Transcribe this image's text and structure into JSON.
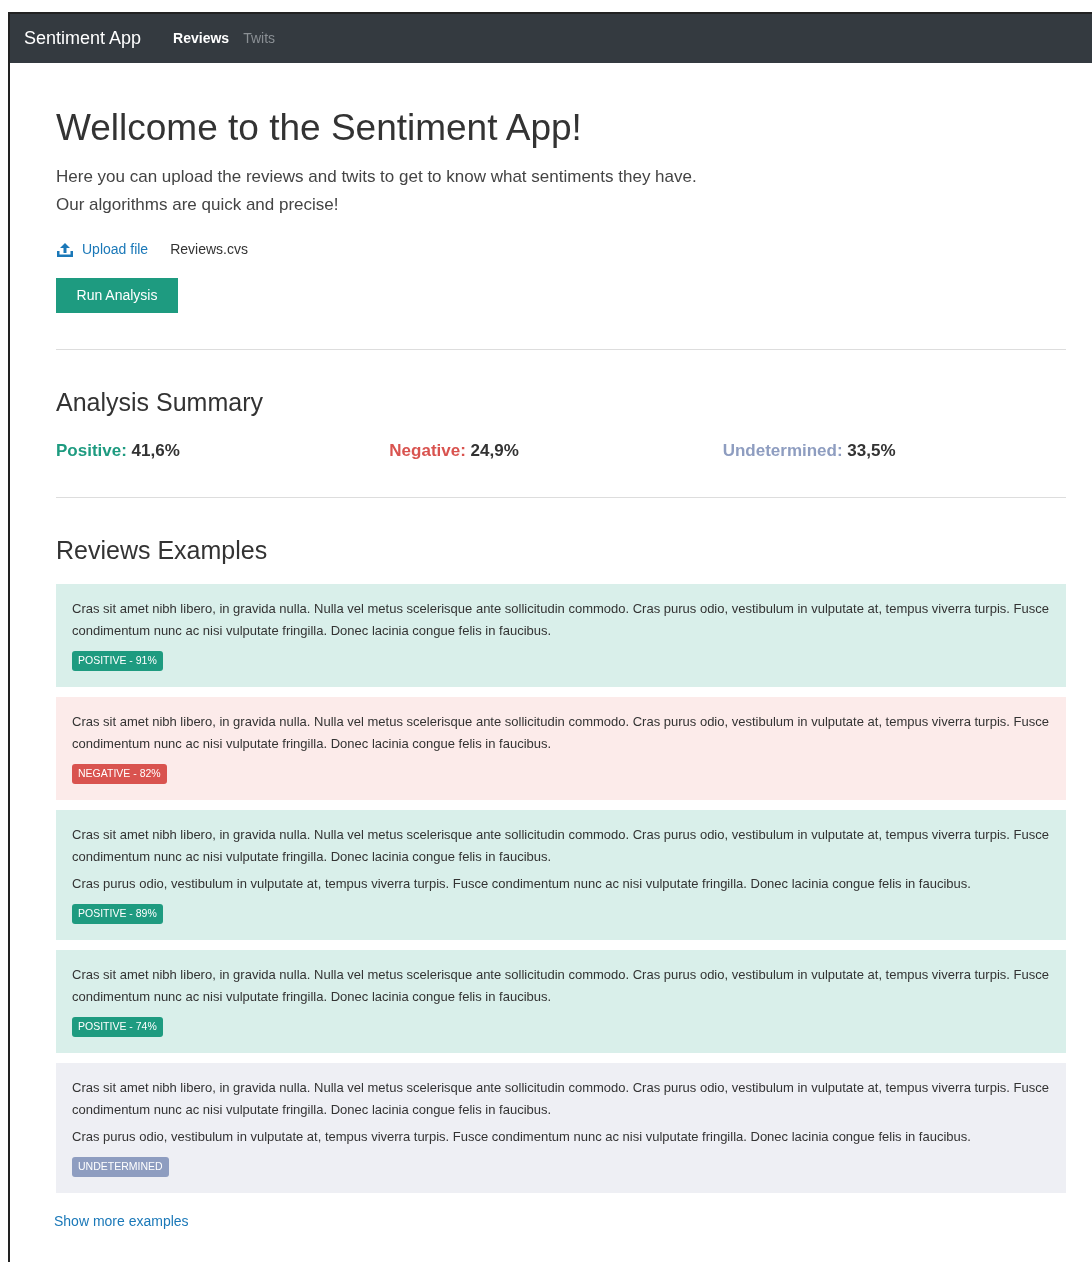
{
  "navbar": {
    "brand": "Sentiment App",
    "tabs": [
      {
        "label": "Reviews",
        "selected": true
      },
      {
        "label": "Twits",
        "selected": false
      }
    ]
  },
  "header": {
    "title": "Wellcome to the Sentiment App!",
    "lines": [
      "Here you can upload the reviews and twits to get to know what sentiments they have.",
      "Our algorithms are quick and precise!"
    ]
  },
  "upload": {
    "link": "Upload file",
    "filename": "Reviews.cvs"
  },
  "run_button": "Run Analysis",
  "summary": {
    "title": "Analysis Summary",
    "items": [
      {
        "kind": "positive",
        "label": "Positive:",
        "value": "41,6%"
      },
      {
        "kind": "negative",
        "label": "Negative:",
        "value": "24,9%"
      },
      {
        "kind": "undetermined",
        "label": "Undetermined:",
        "value": "33,5%"
      }
    ]
  },
  "examples": {
    "title": "Reviews Examples",
    "reviews": [
      {
        "kind": "positive",
        "paragraphs": [
          "Cras sit amet nibh libero, in gravida nulla. Nulla vel metus scelerisque ante sollicitudin commodo. Cras purus odio, vestibulum in vulputate at, tempus viverra turpis. Fusce condimentum nunc ac nisi vulputate fringilla. Donec lacinia congue felis in faucibus."
        ],
        "badge": "POSITIVE - 91%"
      },
      {
        "kind": "negative",
        "paragraphs": [
          "Cras sit amet nibh libero, in gravida nulla. Nulla vel metus scelerisque ante sollicitudin commodo. Cras purus odio, vestibulum in vulputate at, tempus viverra turpis. Fusce condimentum nunc ac nisi vulputate fringilla. Donec lacinia congue felis in faucibus."
        ],
        "badge": "NEGATIVE - 82%"
      },
      {
        "kind": "positive",
        "paragraphs": [
          "Cras sit amet nibh libero, in gravida nulla. Nulla vel metus scelerisque ante sollicitudin commodo. Cras purus odio, vestibulum in vulputate at, tempus viverra turpis. Fusce condimentum nunc ac nisi vulputate fringilla. Donec lacinia congue felis in faucibus.",
          "Cras purus odio, vestibulum in vulputate at, tempus viverra turpis. Fusce condimentum nunc ac nisi vulputate fringilla. Donec lacinia congue felis in faucibus."
        ],
        "badge": "POSITIVE - 89%"
      },
      {
        "kind": "positive",
        "paragraphs": [
          "Cras sit amet nibh libero, in gravida nulla. Nulla vel metus scelerisque ante sollicitudin commodo. Cras purus odio, vestibulum in vulputate at, tempus viverra turpis. Fusce condimentum nunc ac nisi vulputate fringilla. Donec lacinia congue felis in faucibus."
        ],
        "badge": "POSITIVE - 74%"
      },
      {
        "kind": "undetermined",
        "paragraphs": [
          "Cras sit amet nibh libero, in gravida nulla. Nulla vel metus scelerisque ante sollicitudin commodo. Cras purus odio, vestibulum in vulputate at, tempus viverra turpis. Fusce condimentum nunc ac nisi vulputate fringilla. Donec lacinia congue felis in faucibus.",
          "Cras purus odio, vestibulum in vulputate at, tempus viverra turpis. Fusce condimentum nunc ac nisi vulputate fringilla. Donec lacinia congue felis in faucibus."
        ],
        "badge": "UNDETERMINED"
      }
    ],
    "more_link": "Show more examples"
  }
}
